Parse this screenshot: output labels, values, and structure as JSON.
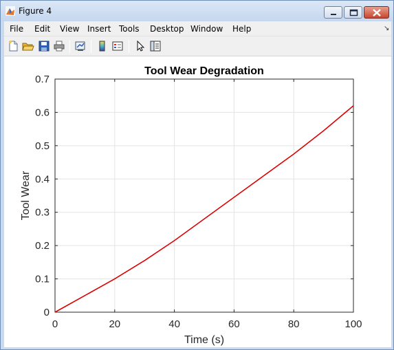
{
  "window": {
    "title": "Figure 4",
    "icons": [
      "matlab-icon",
      "minimize-icon",
      "maximize-icon",
      "close-icon"
    ]
  },
  "menubar": {
    "items": [
      "File",
      "Edit",
      "View",
      "Insert",
      "Tools",
      "Desktop",
      "Window",
      "Help"
    ],
    "overflow_icon": "chevron-icon"
  },
  "toolbar": {
    "icons": [
      "new-figure-icon",
      "open-file-icon",
      "save-icon",
      "print-icon",
      "link-plot-icon",
      "colorbar-icon",
      "legend-icon",
      "pointer-icon",
      "property-inspector-icon"
    ]
  },
  "colors": {
    "line": "#dd0000",
    "grid": "#e3e3e3",
    "axes": "#262626"
  },
  "chart_data": {
    "type": "line",
    "title": "Tool Wear Degradation",
    "xlabel": "Time (s)",
    "ylabel": "Tool Wear",
    "xlim": [
      0,
      100
    ],
    "ylim": [
      0,
      0.7
    ],
    "xticks": [
      0,
      20,
      40,
      60,
      80,
      100
    ],
    "yticks": [
      0,
      0.1,
      0.2,
      0.3,
      0.4,
      0.5,
      0.6,
      0.7
    ],
    "xtick_labels": [
      "0",
      "20",
      "40",
      "60",
      "80",
      "100"
    ],
    "ytick_labels": [
      "0",
      "0.1",
      "0.2",
      "0.3",
      "0.4",
      "0.5",
      "0.6",
      "0.7"
    ],
    "grid": true,
    "series": [
      {
        "color": "#dd0000",
        "x": [
          0,
          10,
          20,
          30,
          40,
          50,
          60,
          70,
          80,
          90,
          100
        ],
        "y": [
          0,
          0.05,
          0.1,
          0.155,
          0.215,
          0.28,
          0.345,
          0.41,
          0.475,
          0.545,
          0.62
        ]
      }
    ]
  }
}
